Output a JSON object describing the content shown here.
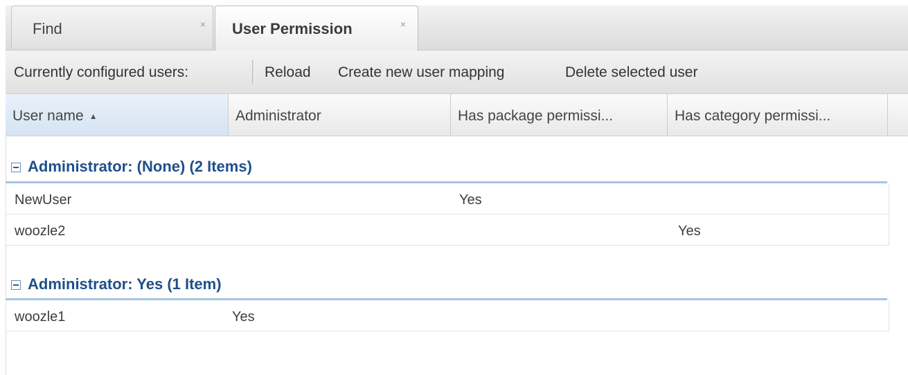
{
  "tabs": [
    {
      "label": "Find",
      "close": "×"
    },
    {
      "label": "User Permission",
      "close": "×"
    }
  ],
  "toolbar": {
    "caption": "Currently configured users:",
    "reload": "Reload",
    "create": "Create new user mapping",
    "delete": "Delete selected user"
  },
  "columns": [
    {
      "label": "User name",
      "sort_indicator": "▲"
    },
    {
      "label": "Administrator"
    },
    {
      "label": "Has package permissi..."
    },
    {
      "label": "Has category permissi..."
    }
  ],
  "groups": [
    {
      "header": "Administrator: (None) (2 Items)",
      "rows": [
        {
          "user": "NewUser",
          "admin": "",
          "package": "Yes",
          "category": ""
        },
        {
          "user": "woozle2",
          "admin": "",
          "package": "",
          "category": "Yes"
        }
      ]
    },
    {
      "header": "Administrator: Yes (1 Item)",
      "rows": [
        {
          "user": "woozle1",
          "admin": "Yes",
          "package": "",
          "category": ""
        }
      ]
    }
  ]
}
